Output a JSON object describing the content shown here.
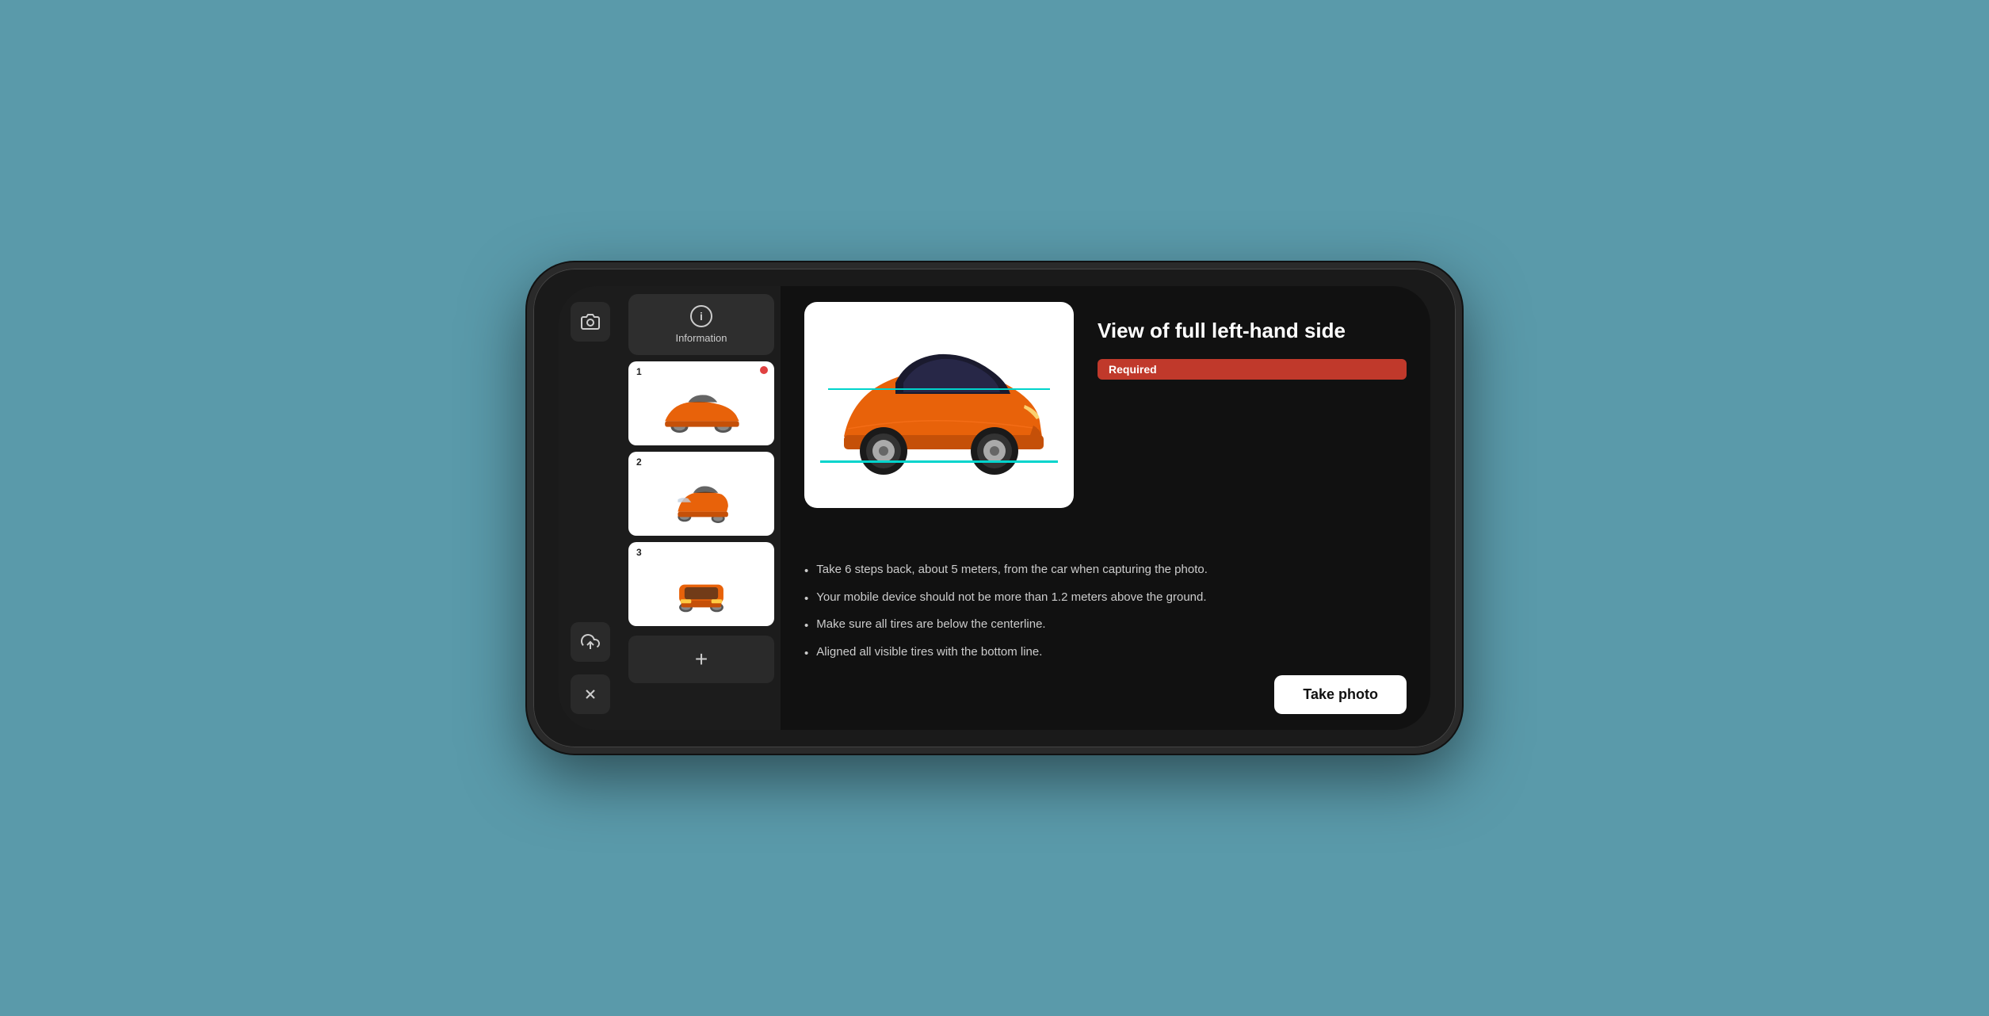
{
  "phone": {
    "screen_bg": "#111"
  },
  "left_toolbar": {
    "camera_icon": "📷",
    "upload_icon": "☁",
    "close_icon": "✕"
  },
  "middle_panel": {
    "info_tab": {
      "label": "Information",
      "icon": "i"
    },
    "thumbnails": [
      {
        "number": "1",
        "has_dot": true,
        "type": "side"
      },
      {
        "number": "2",
        "has_dot": false,
        "type": "front_angle"
      },
      {
        "number": "3",
        "has_dot": false,
        "type": "rear"
      }
    ],
    "add_label": "+"
  },
  "main_content": {
    "view_title": "View of full left-hand side",
    "required_label": "Required",
    "instructions": [
      "Take 6 steps back, about 5 meters, from the car when capturing the photo.",
      "Your mobile device should not be more than 1.2 meters above the ground.",
      "Make sure all tires are below the centerline.",
      "Aligned all visible tires with the bottom line."
    ],
    "take_photo_label": "Take photo"
  }
}
